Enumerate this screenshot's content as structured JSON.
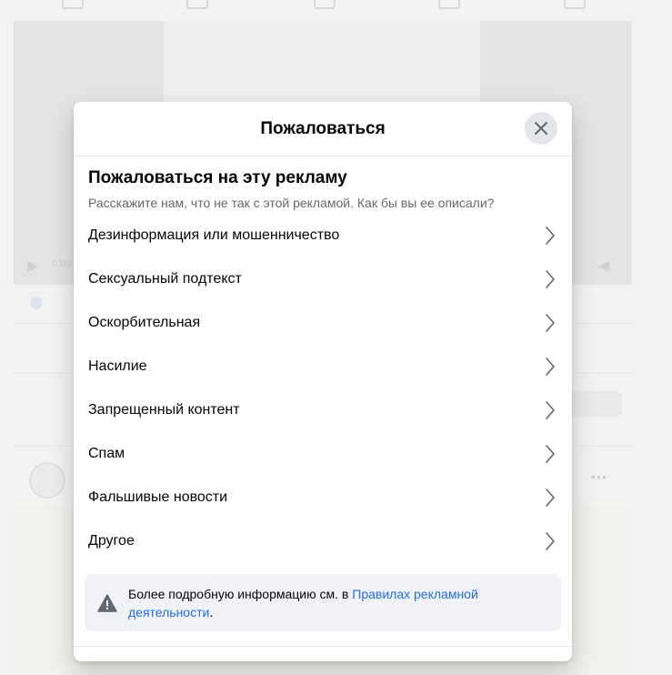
{
  "modal": {
    "title": "Пожаловаться",
    "heading": "Пожаловаться на эту рекламу",
    "subheading": "Расскажите нам, что не так с этой рекламой. Как бы вы ее описали?",
    "options": [
      {
        "label": "Дезинформация или мошенничество"
      },
      {
        "label": "Сексуальный подтекст"
      },
      {
        "label": "Оскорбительная"
      },
      {
        "label": "Насилие"
      },
      {
        "label": "Запрещенный контент"
      },
      {
        "label": "Спам"
      },
      {
        "label": "Фальшивые новости"
      },
      {
        "label": "Другое"
      }
    ],
    "info": {
      "text": "Более подробную информацию см. в ",
      "link": "Правилах рекламной деятельности",
      "suffix": "."
    }
  },
  "background": {
    "video_time": "0:00"
  },
  "icons": {
    "close": "close-icon",
    "chevron": "chevron-right-icon",
    "warning": "warning-icon"
  }
}
